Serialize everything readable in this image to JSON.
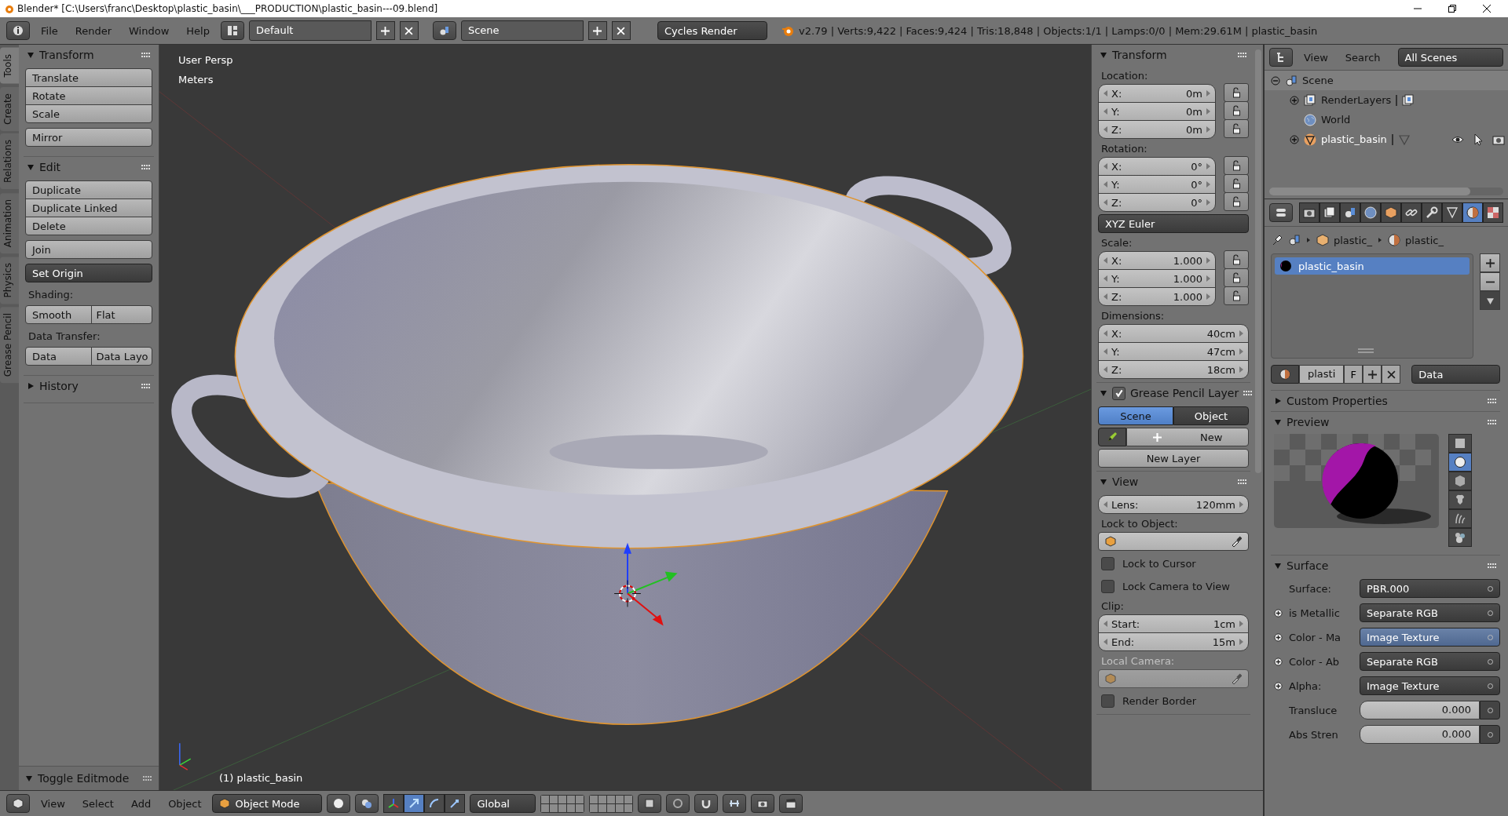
{
  "title_bar": {
    "title": "Blender* [C:\\Users\\franc\\Desktop\\plastic_basin\\___PRODUCTION\\plastic_basin---09.blend]"
  },
  "info_header": {
    "menus": [
      "File",
      "Render",
      "Window",
      "Help"
    ],
    "layout": "Default",
    "scene": "Scene",
    "engine": "Cycles Render",
    "stats": "v2.79 | Verts:9,422 | Faces:9,424 | Tris:18,848 | Objects:1/1 | Lamps:0/0 | Mem:29.61M | plastic_basin"
  },
  "tool_shelf": {
    "tabs": [
      {
        "label": "Tools",
        "selected": true
      },
      {
        "label": "Create",
        "selected": false
      },
      {
        "label": "Relations",
        "selected": false
      },
      {
        "label": "Animation",
        "selected": false
      },
      {
        "label": "Physics",
        "selected": false
      },
      {
        "label": "Grease Pencil",
        "selected": false
      }
    ],
    "panels": [
      {
        "title": "Transform",
        "expanded": true,
        "items": [
          {
            "kind": "stack",
            "buttons": [
              "Translate",
              "Rotate",
              "Scale"
            ]
          },
          {
            "kind": "stack",
            "buttons": [
              "Mirror"
            ]
          }
        ]
      },
      {
        "title": "Edit",
        "expanded": true,
        "items": [
          {
            "kind": "stack",
            "buttons": [
              "Duplicate",
              "Duplicate Linked",
              "Delete"
            ]
          },
          {
            "kind": "stack",
            "buttons": [
              "Join"
            ]
          },
          {
            "kind": "menu",
            "label": "Set Origin"
          },
          {
            "kind": "label",
            "text": "Shading:"
          },
          {
            "kind": "row",
            "buttons": [
              "Smooth",
              "Flat"
            ]
          },
          {
            "kind": "label",
            "text": "Data Transfer:"
          },
          {
            "kind": "row",
            "buttons": [
              "Data",
              "Data Layo"
            ]
          }
        ]
      },
      {
        "title": "History",
        "expanded": false
      }
    ],
    "operator_panel": {
      "title": "Toggle Editmode",
      "expanded": true
    }
  },
  "viewport": {
    "view_name": "User Persp",
    "units": "Meters",
    "object_label": "(1) plastic_basin"
  },
  "n_panel": {
    "panels": [
      {
        "title": "Transform",
        "expanded": true,
        "items": [
          {
            "kind": "label",
            "text": "Location:",
            "disabled": false
          },
          {
            "kind": "vector",
            "locks": true,
            "fields": [
              {
                "axis": "X:",
                "value": "0m"
              },
              {
                "axis": "Y:",
                "value": "0m"
              },
              {
                "axis": "Z:",
                "value": "0m"
              }
            ]
          },
          {
            "kind": "label",
            "text": "Rotation:",
            "disabled": false
          },
          {
            "kind": "vector",
            "locks": true,
            "fields": [
              {
                "axis": "X:",
                "value": "0°"
              },
              {
                "axis": "Y:",
                "value": "0°"
              },
              {
                "axis": "Z:",
                "value": "0°"
              }
            ]
          },
          {
            "kind": "menu",
            "label": "XYZ Euler"
          },
          {
            "kind": "label",
            "text": "Scale:",
            "disabled": false
          },
          {
            "kind": "vector",
            "locks": true,
            "fields": [
              {
                "axis": "X:",
                "value": "1.000"
              },
              {
                "axis": "Y:",
                "value": "1.000"
              },
              {
                "axis": "Z:",
                "value": "1.000"
              }
            ]
          },
          {
            "kind": "label",
            "text": "Dimensions:",
            "disabled": false
          },
          {
            "kind": "vector",
            "locks": false,
            "fields": [
              {
                "axis": "X:",
                "value": "40cm"
              },
              {
                "axis": "Y:",
                "value": "47cm"
              },
              {
                "axis": "Z:",
                "value": "18cm"
              }
            ]
          }
        ]
      },
      {
        "title": "Grease Pencil Layer",
        "expanded": true,
        "toggle": {
          "checked": true
        },
        "items": [
          {
            "kind": "segmented",
            "options": [
              {
                "label": "Scene",
                "selected": true
              },
              {
                "label": "Object",
                "selected": false
              }
            ]
          },
          {
            "kind": "new",
            "label": "New"
          },
          {
            "kind": "button",
            "label": "New Layer"
          }
        ]
      },
      {
        "title": "View",
        "expanded": true,
        "items": [
          {
            "kind": "vector",
            "locks": false,
            "fields": [
              {
                "axis": "Lens:",
                "value": "120mm"
              }
            ]
          },
          {
            "kind": "label",
            "text": "Lock to Object:",
            "disabled": false
          },
          {
            "kind": "object",
            "disabled": false
          },
          {
            "kind": "checkbox",
            "label": "Lock to Cursor",
            "checked": false
          },
          {
            "kind": "checkbox",
            "label": "Lock Camera to View",
            "checked": false
          },
          {
            "kind": "label",
            "text": "Clip:",
            "disabled": false
          },
          {
            "kind": "vector",
            "locks": false,
            "fields": [
              {
                "axis": "Start:",
                "value": "1cm"
              },
              {
                "axis": "End:",
                "value": "15m"
              }
            ]
          },
          {
            "kind": "label",
            "text": "Local Camera:",
            "disabled": true
          },
          {
            "kind": "object",
            "disabled": true
          },
          {
            "kind": "checkbox",
            "label": "Render Border",
            "checked": false
          }
        ]
      }
    ]
  },
  "outliner": {
    "menus": [
      "View",
      "Search"
    ],
    "filter": "All Scenes",
    "tree": [
      {
        "label": "Scene",
        "kind": "scene",
        "expandable": true,
        "expanded": true,
        "children": [
          {
            "label": "RenderLayers",
            "kind": "layers",
            "expandable": true
          },
          {
            "label": "World",
            "kind": "world",
            "expandable": false
          },
          {
            "label": "plastic_basin",
            "kind": "mesh",
            "expandable": true
          }
        ]
      }
    ]
  },
  "properties": {
    "tabs": [
      {
        "kind": "render",
        "selected": false
      },
      {
        "kind": "layers",
        "selected": false
      },
      {
        "kind": "scene",
        "selected": false
      },
      {
        "kind": "world",
        "selected": false
      },
      {
        "kind": "object",
        "selected": false
      },
      {
        "kind": "constraint",
        "selected": false
      },
      {
        "kind": "wrench",
        "selected": false
      },
      {
        "kind": "mesh",
        "selected": false
      },
      {
        "kind": "material",
        "selected": true
      },
      {
        "kind": "texture",
        "selected": false
      }
    ],
    "breadcrumb": [
      "plastic_",
      "plastic_"
    ],
    "slots": [
      {
        "name": "plastic_basin",
        "selected": true
      }
    ],
    "datablock": {
      "name": "plasti",
      "fake_user": "F",
      "type": "Data"
    },
    "panels": [
      {
        "kind": "custom",
        "title": "Custom Properties",
        "expanded": false
      },
      {
        "kind": "preview",
        "title": "Preview",
        "expanded": true,
        "shapes": [
          {
            "kind": "plane",
            "selected": false
          },
          {
            "kind": "sphere",
            "selected": true
          },
          {
            "kind": "cube",
            "selected": false
          },
          {
            "kind": "monkey",
            "selected": false
          },
          {
            "kind": "hair",
            "selected": false
          },
          {
            "kind": "spheres",
            "selected": false
          }
        ]
      },
      {
        "kind": "surface",
        "title": "Surface",
        "expanded": true,
        "surface": {
          "label": "Surface:",
          "value": "PBR.000"
        },
        "inputs": [
          {
            "kind": "link",
            "label": "is Metallic",
            "value": "Separate RGB",
            "highlighted": false
          },
          {
            "kind": "link",
            "label": "Color - Ma",
            "value": "Image Texture",
            "highlighted": true
          },
          {
            "kind": "link",
            "label": "Color - Ab",
            "value": "Separate RGB",
            "highlighted": false
          },
          {
            "kind": "link",
            "label": "Alpha:",
            "value": "Image Texture",
            "highlighted": false
          },
          {
            "kind": "number",
            "label": "Transluce",
            "value": "0.000",
            "highlighted": false
          },
          {
            "kind": "number",
            "label": "Abs Stren",
            "value": "0.000",
            "highlighted": false
          }
        ]
      }
    ]
  },
  "view_header": {
    "menus": [
      "View",
      "Select",
      "Add",
      "Object"
    ],
    "mode": "Object Mode",
    "manipulators": [
      {
        "kind": "axes",
        "selected": false
      },
      {
        "kind": "translate",
        "selected": true
      },
      {
        "kind": "rotate",
        "selected": false
      },
      {
        "kind": "scale",
        "selected": false
      }
    ],
    "orientation": "Global"
  }
}
